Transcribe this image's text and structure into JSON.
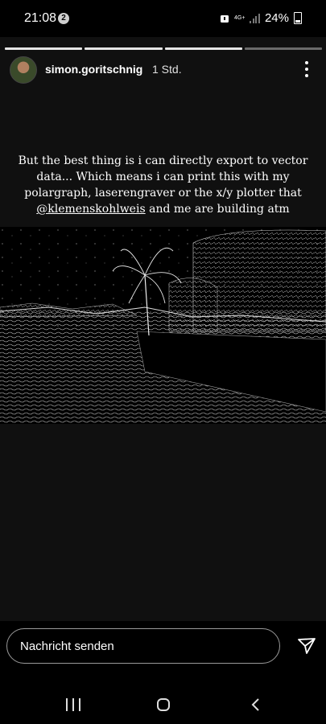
{
  "status_bar": {
    "time": "21:08",
    "notification_count": "2",
    "network": "4G+",
    "battery": "24%"
  },
  "story": {
    "progress": {
      "segments": 4,
      "current": 3
    },
    "username": "simon.goritschnig",
    "time_ago": "1 Std.",
    "caption_lines": [
      "But the best thing is i can directly export to vector",
      "data... Which means i can print this with my",
      "polargraph, laserengraver or the x/y plotter that"
    ],
    "caption_mention": "@klemenskohlweis",
    "caption_end": " and me are building atm"
  },
  "composer": {
    "placeholder": "Nachricht senden"
  },
  "icons": {
    "more": "more-vertical-icon",
    "send": "send-icon",
    "recent": "recent-apps-icon",
    "home": "home-icon",
    "back": "back-icon"
  },
  "colors": {
    "background": "#000000",
    "story_background": "#101010",
    "progress_done": "#e6e6e6",
    "progress_pending": "#6b6b6b"
  }
}
